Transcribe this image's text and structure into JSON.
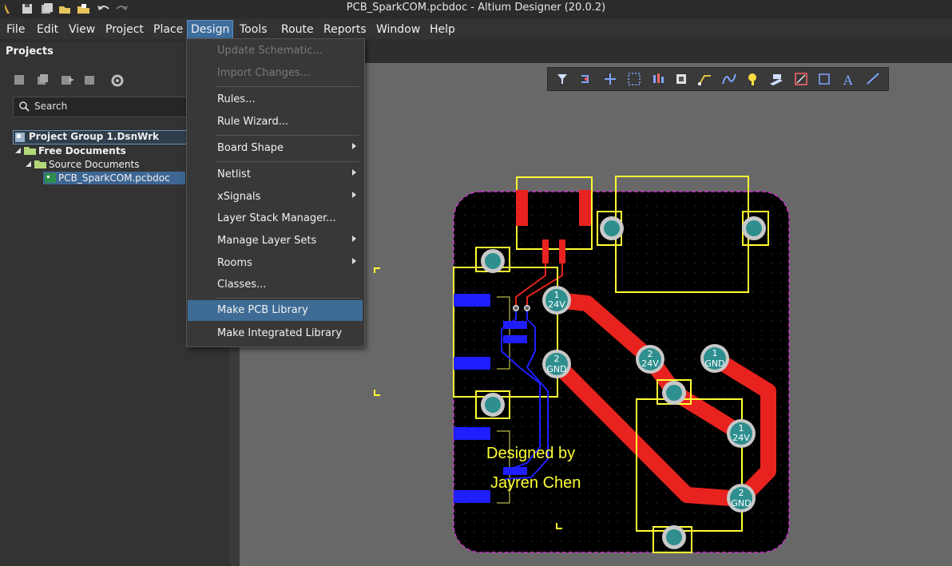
{
  "window": {
    "title": "PCB_SparkCOM.pcbdoc - Altium Designer (20.0.2)"
  },
  "menubar": {
    "items": [
      "File",
      "Edit",
      "View",
      "Project",
      "Place",
      "Design",
      "Tools",
      "Route",
      "Reports",
      "Window",
      "Help"
    ],
    "active": "Design"
  },
  "projects_panel": {
    "title": "Projects",
    "search_placeholder": "Search",
    "tree": {
      "group": "Project Group 1.DsnWrk",
      "folder": "Free Documents",
      "subfolder": "Source Documents",
      "file": "PCB_SparkCOM.pcbdoc"
    }
  },
  "design_menu": {
    "items": [
      {
        "label": "Update Schematic...",
        "disabled": true
      },
      {
        "label": "Import Changes...",
        "disabled": true
      },
      {
        "label": "Rules..."
      },
      {
        "label": "Rule Wizard..."
      },
      {
        "label": "Board Shape",
        "submenu": true
      },
      {
        "label": "Netlist",
        "submenu": true
      },
      {
        "label": "xSignals",
        "submenu": true
      },
      {
        "label": "Layer Stack Manager..."
      },
      {
        "label": "Manage Layer Sets",
        "submenu": true
      },
      {
        "label": "Rooms",
        "submenu": true
      },
      {
        "label": "Classes..."
      },
      {
        "label": "Make PCB Library",
        "highlighted": true
      },
      {
        "label": "Make Integrated Library"
      }
    ]
  },
  "pcb": {
    "silkscreen_line1": "Designed by",
    "silkscreen_line2": "Jayren Chen",
    "pads": [
      {
        "num": "1",
        "net": "24V"
      },
      {
        "num": "2",
        "net": "GND"
      },
      {
        "num": "2",
        "net": "24V"
      },
      {
        "num": "1",
        "net": "GND"
      },
      {
        "num": "1",
        "net": "24V"
      },
      {
        "num": "2",
        "net": "GND"
      }
    ]
  },
  "colors": {
    "board": "#000000",
    "top_copper": "#e8231f",
    "bottom_copper": "#1e1eff",
    "silkscreen": "#ffff33",
    "board_outline": "#cc33cc",
    "pad": "#3b9a9a",
    "menu_highlight": "#3f6c96"
  }
}
